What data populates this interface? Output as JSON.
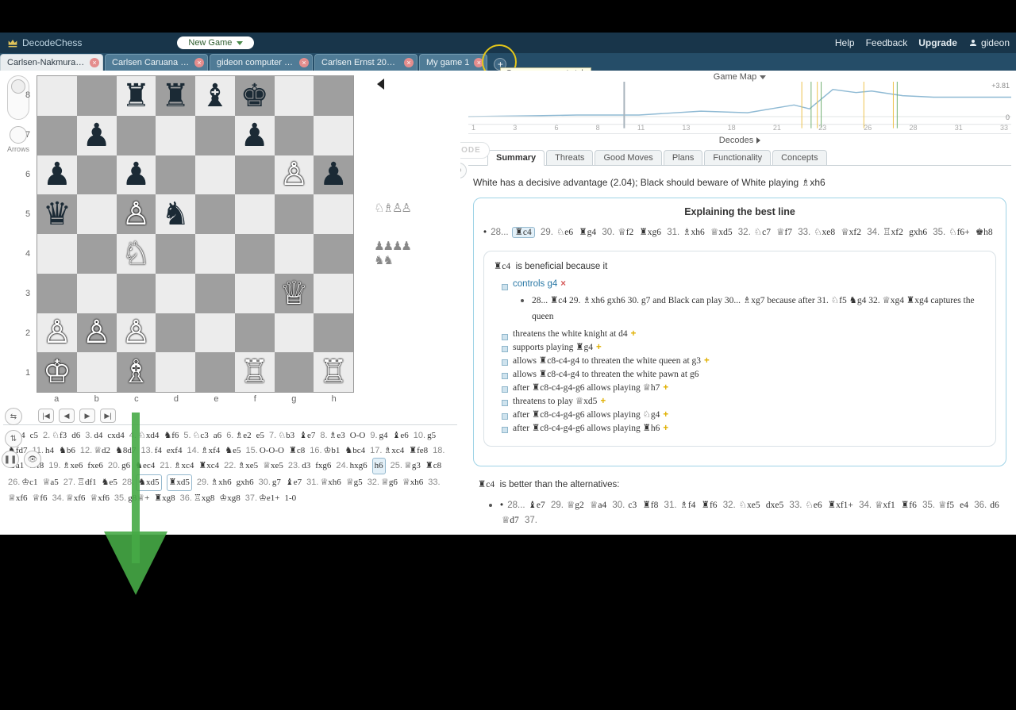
{
  "nav": {
    "brand": "DecodeChess",
    "new_game": "New Game",
    "links": {
      "help": "Help",
      "feedback": "Feedback",
      "upgrade": "Upgrade"
    },
    "user": "gideon"
  },
  "tabs": [
    {
      "label": "Carlsen-Nakmura 201...",
      "active": true
    },
    {
      "label": "Carlsen Caruana 2018..."
    },
    {
      "label": "gideon computer 2018..."
    },
    {
      "label": "Carlsen Ernst 2004.01..."
    },
    {
      "label": "My game 1"
    }
  ],
  "new_tab_tooltip": "Open a new empty tab",
  "side": {
    "arrows": "Arrows"
  },
  "board": {
    "files": [
      "a",
      "b",
      "c",
      "d",
      "e",
      "f",
      "g",
      "h"
    ],
    "ranks": [
      "8",
      "7",
      "6",
      "5",
      "4",
      "3",
      "2",
      "1"
    ],
    "position": {
      "a1": "wK",
      "c1": "wB",
      "f1": "wR",
      "h1": "wR",
      "a2": "wP",
      "b2": "wP",
      "c2": "wP",
      "g3": "wQ",
      "c4": "wN",
      "c5": "wP",
      "d5": "bN",
      "g6": "wP",
      "a5": "bQ",
      "a6": "bP",
      "c6": "bP",
      "h6": "bP",
      "b7": "bP",
      "f7": "bP",
      "c8": "bR",
      "d8": "bR",
      "e8": "bB",
      "f8": "bK"
    },
    "arrow_from": "c8",
    "arrow_to": "c4",
    "navBtns": [
      "|◀",
      "◀",
      "▶",
      "▶|"
    ]
  },
  "captured": {
    "top": "♘♗♙♙",
    "bottom": "♟♟♟♟\n♞♞"
  },
  "map": {
    "title": "Game Map",
    "ticks": [
      "1",
      "3",
      "6",
      "8",
      "11",
      "13",
      "18",
      "21",
      "23",
      "26",
      "28",
      "31",
      "33"
    ],
    "hi": "+3.81",
    "lo": "0",
    "decodes": "Decodes"
  },
  "decode_badge": "DECODE",
  "anaTabs": [
    "Summary",
    "Threats",
    "Good Moves",
    "Plans",
    "Functionality",
    "Concepts"
  ],
  "summaryLine": "White has a decisive advantage (2.04); Black should beware of White playing  ♗xh6",
  "bestLine": {
    "title": "Explaining the best line",
    "moves": [
      {
        "n": "28...",
        "m": "♜c4",
        "hl": true
      },
      {
        "n": "29.",
        "m": "♘e6"
      },
      {
        "n": "",
        "m": "♜g4"
      },
      {
        "n": "30.",
        "m": "♕f2"
      },
      {
        "n": "",
        "m": "♜xg6"
      },
      {
        "n": "31.",
        "m": "♗xh6"
      },
      {
        "n": "",
        "m": "♕xd5"
      },
      {
        "n": "32.",
        "m": "♘c7"
      },
      {
        "n": "",
        "m": "♕f7"
      },
      {
        "n": "33.",
        "m": "♘xe8"
      },
      {
        "n": "",
        "m": "♕xf2"
      },
      {
        "n": "34.",
        "m": "♖xf2"
      },
      {
        "n": "",
        "m": "gxh6"
      },
      {
        "n": "35.",
        "m": "♘f6+"
      },
      {
        "n": "",
        "m": "♚h8"
      }
    ]
  },
  "explain": {
    "intro": [
      "♜c4",
      "is beneficial because it"
    ],
    "bullets": [
      {
        "type": "link",
        "text": "controls g4",
        "red": true,
        "sub": {
          "pre": "28... ♜c4  29. ♗xh6  gxh6  30. g7   and Black can play   30... ♗xg7    because after 31. ♘f5  ♞g4  32. ♕xg4  ♜xg4  captures the queen"
        }
      },
      {
        "text": "threatens the white knight at d4",
        "plus": true
      },
      {
        "text": "supports playing  ♜g4",
        "plus": true
      },
      {
        "text": "allows ♜c8-c4-g4 to threaten the white queen at g3",
        "plus": true
      },
      {
        "text": "allows ♜c8-c4-g4 to threaten the white pawn at g6"
      },
      {
        "text": "after ♜c8-c4-g4-g6 allows playing  ♕h7",
        "plus": true
      },
      {
        "text": "threatens to play  ♕xd5",
        "plus": true
      },
      {
        "text": "after ♜c8-c4-g4-g6 allows playing  ♘g4",
        "plus": true
      },
      {
        "text": "after ♜c8-c4-g4-g6 allows playing  ♜h6",
        "plus": true
      }
    ],
    "alt_intro": [
      "♜c4",
      "is better than the alternatives:"
    ],
    "alt": [
      {
        "n": "28...",
        "m": "♝e7"
      },
      {
        "n": "29.",
        "m": "♕g2"
      },
      {
        "n": "",
        "m": "♕a4"
      },
      {
        "n": "30.",
        "m": "c3"
      },
      {
        "n": "",
        "m": "♜f8"
      },
      {
        "n": "31.",
        "m": "♗f4"
      },
      {
        "n": "",
        "m": "♜f6"
      },
      {
        "n": "32.",
        "m": "♘xe5"
      },
      {
        "n": "",
        "m": "dxe5"
      },
      {
        "n": "33.",
        "m": "♘e6"
      },
      {
        "n": "",
        "m": "♜xf1+"
      },
      {
        "n": "34.",
        "m": "♕xf1"
      },
      {
        "n": "",
        "m": "♜f6"
      },
      {
        "n": "35.",
        "m": "♕f5"
      },
      {
        "n": "",
        "m": "e4"
      },
      {
        "n": "36.",
        "m": "d6"
      },
      {
        "n": "",
        "m": "♕d7"
      },
      {
        "n": "37.",
        "m": ""
      }
    ]
  },
  "movelist": [
    {
      "n": 1,
      "w": "e4",
      "b": "c5"
    },
    {
      "n": 2,
      "w": "♘f3",
      "b": "d6"
    },
    {
      "n": 3,
      "w": "d4",
      "b": "cxd4"
    },
    {
      "n": 4,
      "w": "♘xd4",
      "b": "♞f6"
    },
    {
      "n": 5,
      "w": "♘c3",
      "b": "a6"
    },
    {
      "n": 6,
      "w": "♗e2",
      "b": "e5"
    },
    {
      "n": 7,
      "w": "♘b3",
      "b": "♝e7"
    },
    {
      "n": 8,
      "w": "♗e3",
      "b": "O-O"
    },
    {
      "n": 9,
      "w": "g4",
      "b": "♝e6"
    },
    {
      "n": 10,
      "w": "g5",
      "b": ""
    },
    {
      "n": "",
      "w": "♞fd7",
      "b": ""
    },
    {
      "n": 11,
      "w": "h4",
      "b": "♞b6"
    },
    {
      "n": 12,
      "w": "♕d2",
      "b": "♞8d7"
    },
    {
      "n": 13,
      "w": "f4",
      "b": "exf4"
    },
    {
      "n": 14,
      "w": "♗xf4",
      "b": "♞e5"
    },
    {
      "n": 15,
      "w": "O-O-O",
      "b": "♜c8"
    },
    {
      "n": 16,
      "w": "♔b1",
      "b": "♞bc4"
    },
    {
      "n": 17,
      "w": "♗xc4",
      "b": "♜fe8"
    },
    {
      "n": 18,
      "w": "♞a1",
      "b": ""
    },
    {
      "n": "",
      "w": "♜f8",
      "b": ""
    },
    {
      "n": 19,
      "w": "♗xe6",
      "b": "fxe6"
    },
    {
      "n": 20,
      "w": "g6",
      "b": "♞ec4"
    },
    {
      "n": 21,
      "w": "♗xc4",
      "b": "♜xc4"
    },
    {
      "n": 22,
      "w": "♗xe5",
      "b": "♕xe5"
    },
    {
      "n": 23,
      "w": "d3",
      "b": "fxg6"
    },
    {
      "n": 24,
      "w": "hxg6",
      "b": "h6",
      "b_u": true
    },
    {
      "n": 25,
      "w": "♕g3",
      "b": "♜c8"
    },
    {
      "n": 26,
      "w": "♔c1",
      "b": "♕a5"
    },
    {
      "n": "",
      "w": "",
      "b": ""
    },
    {
      "n": 27,
      "w": "♖df1",
      "b": "♞e5"
    },
    {
      "n": 28,
      "w": "♞xd5",
      "box": true,
      "b": "♜xd5",
      "box2": true
    },
    {
      "n": 29,
      "w": "♗xh6",
      "b": "gxh6"
    },
    {
      "n": 30,
      "w": "g7",
      "b": "♝e7"
    },
    {
      "n": 31,
      "w": "♕xh6",
      "b": "♕g5"
    },
    {
      "n": 32,
      "w": "♕g6",
      "b": "♕xh6"
    },
    {
      "n": 33,
      "w": "♕xf6",
      "b": "♕f6"
    },
    {
      "n": 34,
      "w": "♕xf6",
      "b": "♕xf6"
    },
    {
      "n": 35,
      "w": "g8♕+",
      "b": "♜xg8"
    },
    {
      "n": 36,
      "w": "♖xg8",
      "b": "♔xg8"
    },
    {
      "n": 37,
      "w": "♔e1+",
      "b": "1-0"
    }
  ]
}
